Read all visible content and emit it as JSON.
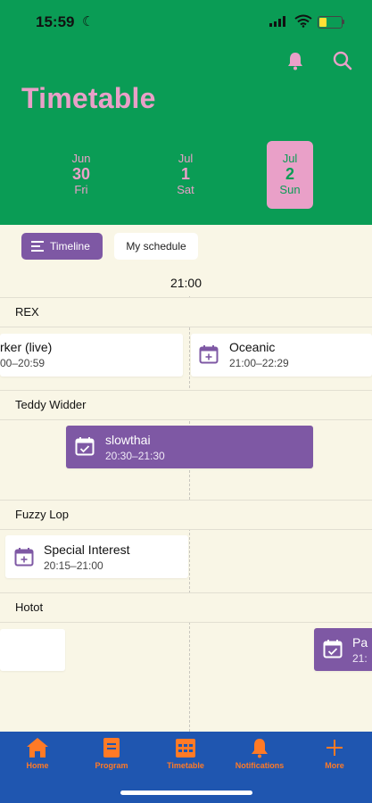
{
  "status_bar": {
    "time": "15:59"
  },
  "header": {
    "title": "Timetable"
  },
  "days": [
    {
      "month": "Jun",
      "date": "30",
      "weekday": "Fri",
      "selected": false
    },
    {
      "month": "Jul",
      "date": "1",
      "weekday": "Sat",
      "selected": false
    },
    {
      "month": "Jul",
      "date": "2",
      "weekday": "Sun",
      "selected": true
    }
  ],
  "view_toggle": {
    "timeline": "Timeline",
    "my_schedule": "My schedule"
  },
  "timeline": {
    "time_label": "21:00"
  },
  "stages": [
    {
      "name": "REX"
    },
    {
      "name": "Teddy Widder"
    },
    {
      "name": "Fuzzy Lop"
    },
    {
      "name": "Hotot"
    }
  ],
  "events": {
    "rex_left": {
      "name": "rker (live)",
      "time": "00–20:59"
    },
    "oceanic": {
      "name": "Oceanic",
      "time": "21:00–22:29"
    },
    "slowthai": {
      "name": "slowthai",
      "time": "20:30–21:30"
    },
    "special_interest": {
      "name": "Special Interest",
      "time": "20:15–21:00"
    },
    "hotot_right": {
      "name": "Pa",
      "time": "21:"
    }
  },
  "nav": [
    {
      "label": "Home",
      "icon": "home-icon"
    },
    {
      "label": "Program",
      "icon": "program-icon"
    },
    {
      "label": "Timetable",
      "icon": "timetable-icon"
    },
    {
      "label": "Notifications",
      "icon": "bell-icon"
    },
    {
      "label": "More",
      "icon": "plus-icon"
    }
  ],
  "colors": {
    "header": "#0a9c55",
    "accent_pink": "#e9a0c8",
    "purple": "#7e58a4",
    "nav": "#1f56b0",
    "nav_item": "#ff7a26",
    "background": "#f9f6e6"
  }
}
